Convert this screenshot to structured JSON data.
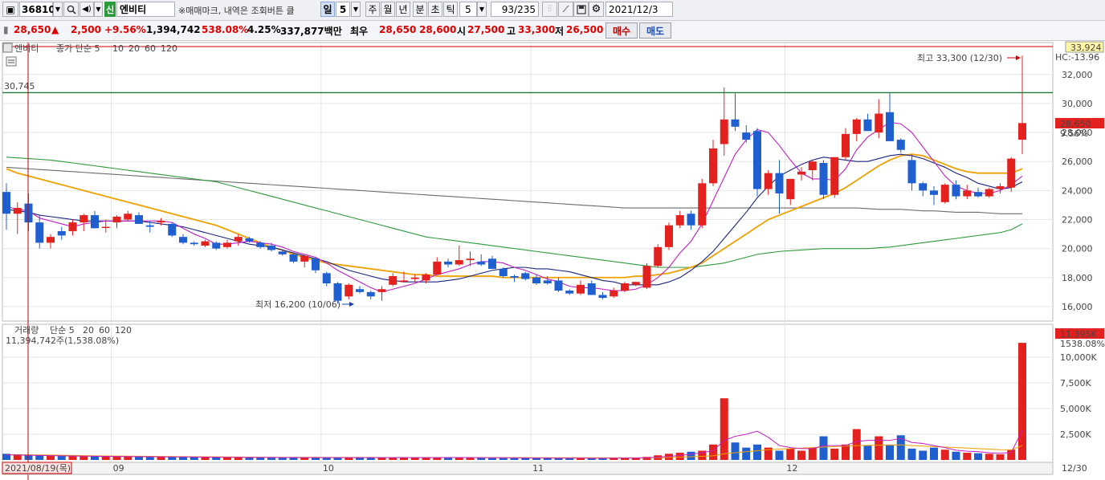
{
  "toolbar": {
    "stock_code": "36810",
    "stock_badge": "신",
    "stock_name": "엔비티",
    "notice": "※매매마크, 내역은 조회버튼 클",
    "periods": [
      "일",
      "5",
      "주",
      "월",
      "년",
      "분",
      "초",
      "틱"
    ],
    "selected_period": "일",
    "minute_value": "5",
    "count": "93/235",
    "date": "2021/12/3"
  },
  "quote": {
    "price": "28,650",
    "change_arrow": "▲",
    "change": "2,500",
    "change_pct": "+9.56%",
    "volume": "1,394,742",
    "volume_ratio": "538.08%",
    "turnover": "4.25%",
    "amount": "337,877백만",
    "bid_label": "최우",
    "ask": "28,650",
    "bid": "28,600",
    "open_label": "시",
    "open": "27,500",
    "high_label": "고",
    "high": "33,300",
    "low_label": "저",
    "low": "26,500",
    "buy_button": "매수",
    "sell_button": "매도"
  },
  "price_panel": {
    "legend_name": "엔비티",
    "legend_ma": "종가 단순 5",
    "ma_periods": [
      "10",
      "20",
      "60",
      "120"
    ],
    "hline_value": "30,745",
    "max_label": "최고 33,300 (12/30)",
    "min_label": "최저 16,200 (10/06)",
    "top_axis_value": "33,924",
    "hc_label": "HC:-13.96",
    "current_price_tag": "28,650",
    "current_pct_tag": "9.56%",
    "y_ticks": [
      "32,000",
      "30,000",
      "28,000",
      "26,000",
      "24,000",
      "22,000",
      "20,000",
      "18,000",
      "16,000"
    ]
  },
  "volume_panel": {
    "legend_name": "거래량",
    "legend_ma": "단순 5",
    "ma_periods": [
      "20",
      "60",
      "120"
    ],
    "current_volume": "11,394,742주(1,538.08%)",
    "current_tag": "11,395K",
    "current_pct_tag": "1538.08%",
    "y_ticks": [
      "10,000K",
      "7,500K",
      "5,000K",
      "2,500K"
    ]
  },
  "x_axis": {
    "start_date": "2021/08/19(목)",
    "month_labels": [
      "09",
      "10",
      "11",
      "12"
    ],
    "end_label": "12/30"
  },
  "colors": {
    "up": "#e3211f",
    "down": "#1f5fd0",
    "ma5": "#c21fc4",
    "ma10": "#1a237e",
    "ma20": "#f0a000",
    "ma60": "#2e9a3c",
    "ma120": "#6b6b6b",
    "hline": "#1f7a3a",
    "high_line": "#cc0000"
  },
  "chart_data": {
    "type": "candlestick",
    "start_date": "2021-08-19",
    "end_date": "2021-12-30",
    "unit": "KRW",
    "ylim": [
      15000,
      33924
    ],
    "candles": [
      [
        23900,
        24500,
        21300,
        22400
      ],
      [
        22400,
        23200,
        21000,
        22800
      ],
      [
        23100,
        23800,
        21200,
        21800
      ],
      [
        21800,
        22300,
        20000,
        20400
      ],
      [
        20400,
        21000,
        20000,
        20800
      ],
      [
        21200,
        21500,
        20600,
        20900
      ],
      [
        21200,
        22000,
        20900,
        21800
      ],
      [
        21800,
        22400,
        21200,
        22300
      ],
      [
        22300,
        22600,
        21400,
        21400
      ],
      [
        21500,
        22000,
        21100,
        21500
      ],
      [
        21800,
        22300,
        21400,
        22200
      ],
      [
        22000,
        22600,
        21900,
        22400
      ],
      [
        22300,
        22500,
        21700,
        21700
      ],
      [
        21600,
        21900,
        21100,
        21500
      ],
      [
        21800,
        22100,
        21600,
        21900
      ],
      [
        21700,
        21800,
        20800,
        20900
      ],
      [
        20800,
        21000,
        20300,
        20400
      ],
      [
        20400,
        20500,
        20200,
        20300
      ],
      [
        20200,
        20600,
        20100,
        20500
      ],
      [
        20400,
        20500,
        19900,
        20000
      ],
      [
        20100,
        20600,
        20000,
        20400
      ],
      [
        20500,
        21000,
        20200,
        20800
      ],
      [
        20700,
        20800,
        20400,
        20500
      ],
      [
        20400,
        20500,
        20000,
        20100
      ],
      [
        20200,
        20400,
        19800,
        19900
      ],
      [
        19800,
        19900,
        19500,
        19600
      ],
      [
        19600,
        19700,
        19000,
        19100
      ],
      [
        19100,
        19600,
        18700,
        19500
      ],
      [
        19300,
        19400,
        18300,
        18500
      ],
      [
        18300,
        18400,
        17400,
        17600
      ],
      [
        17600,
        17700,
        16200,
        16400
      ],
      [
        16700,
        17600,
        16500,
        17500
      ],
      [
        17200,
        17400,
        16900,
        17000
      ],
      [
        17000,
        17100,
        16500,
        16700
      ],
      [
        17000,
        17400,
        16400,
        17200
      ],
      [
        17500,
        18300,
        17400,
        18100
      ],
      [
        17700,
        18400,
        17700,
        17800
      ],
      [
        17900,
        18200,
        17700,
        18000
      ],
      [
        17800,
        18300,
        17600,
        18200
      ],
      [
        18200,
        19400,
        18200,
        19100
      ],
      [
        19100,
        19300,
        18700,
        18900
      ],
      [
        18900,
        20200,
        18800,
        19200
      ],
      [
        19200,
        19800,
        18800,
        19300
      ],
      [
        19100,
        19600,
        18800,
        18900
      ],
      [
        19300,
        19500,
        18600,
        18600
      ],
      [
        18600,
        18700,
        18000,
        18100
      ],
      [
        18100,
        18200,
        17700,
        18000
      ],
      [
        18300,
        18400,
        17800,
        17900
      ],
      [
        18000,
        18200,
        17500,
        17600
      ],
      [
        17800,
        18100,
        17500,
        17600
      ],
      [
        17800,
        18000,
        17000,
        17100
      ],
      [
        17100,
        17200,
        16800,
        16900
      ],
      [
        16900,
        17800,
        16800,
        17500
      ],
      [
        17600,
        17800,
        16800,
        16800
      ],
      [
        16800,
        17000,
        16500,
        16600
      ],
      [
        16700,
        17300,
        16600,
        17100
      ],
      [
        17100,
        17700,
        17000,
        17600
      ],
      [
        17500,
        17700,
        17400,
        17700
      ],
      [
        17300,
        19000,
        17200,
        18800
      ],
      [
        18800,
        20300,
        18700,
        20100
      ],
      [
        20100,
        21800,
        19900,
        21600
      ],
      [
        21600,
        22600,
        21400,
        22300
      ],
      [
        22400,
        22600,
        21300,
        21600
      ],
      [
        21600,
        24800,
        21400,
        24500
      ],
      [
        24500,
        27500,
        24300,
        26900
      ],
      [
        27200,
        31100,
        26400,
        28900
      ],
      [
        28900,
        30700,
        28100,
        28400
      ],
      [
        28000,
        28500,
        27300,
        27500
      ],
      [
        28100,
        28300,
        23600,
        24100
      ],
      [
        24100,
        25400,
        23700,
        25200
      ],
      [
        25200,
        26100,
        22400,
        23800
      ],
      [
        23400,
        24800,
        23000,
        24800
      ],
      [
        25100,
        25600,
        24700,
        25300
      ],
      [
        25400,
        26100,
        24700,
        26000
      ],
      [
        25900,
        26100,
        23400,
        23700
      ],
      [
        23700,
        26200,
        23500,
        26300
      ],
      [
        26300,
        28300,
        26100,
        27900
      ],
      [
        27900,
        29000,
        27400,
        28900
      ],
      [
        28900,
        29300,
        28400,
        28100
      ],
      [
        28000,
        30300,
        27600,
        29300
      ],
      [
        29400,
        30700,
        28700,
        27400
      ],
      [
        27500,
        27600,
        26600,
        26800
      ],
      [
        26100,
        26500,
        24000,
        24500
      ],
      [
        24500,
        24600,
        23600,
        24000
      ],
      [
        24000,
        24300,
        23000,
        23700
      ],
      [
        23200,
        24500,
        23100,
        24400
      ],
      [
        24400,
        24700,
        23400,
        23600
      ],
      [
        23600,
        24400,
        23400,
        24000
      ],
      [
        23900,
        24200,
        23500,
        23600
      ],
      [
        23600,
        24200,
        23500,
        24100
      ],
      [
        24100,
        24500,
        23800,
        24300
      ],
      [
        24200,
        26300,
        23900,
        26200
      ],
      [
        27500,
        33300,
        26500,
        28650
      ]
    ],
    "ma5": [
      22900,
      22700,
      22600,
      22100,
      21900,
      21700,
      21500,
      21700,
      21800,
      21900,
      21900,
      21900,
      21900,
      21900,
      21900,
      21800,
      21400,
      21000,
      20700,
      20300,
      20300,
      20400,
      20500,
      20400,
      20300,
      20100,
      19800,
      19600,
      19400,
      19000,
      18500,
      18100,
      17700,
      17300,
      17000,
      17200,
      17400,
      17600,
      17900,
      18200,
      18400,
      18600,
      18900,
      19100,
      19100,
      19000,
      18700,
      18500,
      18200,
      17900,
      17700,
      17400,
      17300,
      17300,
      17200,
      17100,
      17100,
      17200,
      17500,
      18000,
      18700,
      19700,
      20500,
      21700,
      23300,
      24900,
      26500,
      27500,
      28200,
      28000,
      27100,
      26100,
      25200,
      24800,
      24800,
      24700,
      25500,
      26800,
      27700,
      28200,
      28700,
      28600,
      28000,
      27000,
      26000,
      25000,
      24300,
      24000,
      23800,
      23800,
      24000,
      24400,
      25000
    ],
    "ma10": [
      22700,
      22600,
      22500,
      22300,
      22200,
      22100,
      22000,
      21900,
      21900,
      21900,
      21900,
      21900,
      21900,
      21800,
      21700,
      21600,
      21500,
      21300,
      21100,
      20900,
      20700,
      20500,
      20300,
      20200,
      20100,
      19900,
      19700,
      19500,
      19300,
      19100,
      18800,
      18500,
      18300,
      18100,
      17900,
      17800,
      17700,
      17700,
      17700,
      17700,
      17800,
      17900,
      18100,
      18300,
      18500,
      18600,
      18700,
      18700,
      18600,
      18600,
      18500,
      18400,
      18200,
      18000,
      17800,
      17700,
      17500,
      17500,
      17500,
      17500,
      17700,
      18000,
      18500,
      19100,
      19800,
      20700,
      21600,
      22500,
      23500,
      24300,
      25000,
      25400,
      25800,
      26100,
      26300,
      26200,
      26100,
      26000,
      26000,
      26200,
      26400,
      26500,
      26400,
      26200,
      25900,
      25600,
      25200,
      24900,
      24500,
      24300,
      24100,
      24200,
      24600
    ],
    "ma20": [
      25500,
      25200,
      25000,
      24800,
      24600,
      24400,
      24200,
      24000,
      23800,
      23600,
      23400,
      23200,
      23000,
      22800,
      22600,
      22400,
      22200,
      22000,
      21800,
      21600,
      21300,
      21000,
      20700,
      20400,
      20100,
      19900,
      19600,
      19400,
      19200,
      19000,
      18900,
      18800,
      18700,
      18600,
      18500,
      18400,
      18300,
      18200,
      18200,
      18100,
      18100,
      18100,
      18100,
      18100,
      18100,
      18000,
      18000,
      18000,
      18000,
      18000,
      18000,
      18000,
      18000,
      18000,
      18000,
      18000,
      18000,
      18100,
      18100,
      18200,
      18300,
      18500,
      18700,
      19000,
      19500,
      20000,
      20500,
      21000,
      21500,
      22000,
      22300,
      22600,
      22900,
      23200,
      23500,
      23800,
      24200,
      24700,
      25200,
      25700,
      26100,
      26400,
      26500,
      26400,
      26100,
      25800,
      25500,
      25300,
      25200,
      25200,
      25200,
      25200,
      25500
    ],
    "ma60": [
      26300,
      26250,
      26200,
      26150,
      26100,
      26000,
      25900,
      25800,
      25700,
      25600,
      25500,
      25400,
      25300,
      25200,
      25100,
      25000,
      24900,
      24800,
      24700,
      24600,
      24400,
      24200,
      24000,
      23800,
      23600,
      23400,
      23200,
      23000,
      22800,
      22600,
      22400,
      22200,
      22000,
      21800,
      21600,
      21400,
      21200,
      21000,
      20800,
      20700,
      20600,
      20500,
      20400,
      20300,
      20200,
      20100,
      20000,
      19900,
      19800,
      19700,
      19600,
      19500,
      19400,
      19300,
      19200,
      19100,
      19000,
      18900,
      18800,
      18700,
      18700,
      18700,
      18700,
      18800,
      18900,
      19000,
      19200,
      19400,
      19600,
      19700,
      19800,
      19850,
      19900,
      19950,
      20000,
      20000,
      20000,
      20000,
      20000,
      20050,
      20100,
      20200,
      20300,
      20400,
      20500,
      20600,
      20700,
      20800,
      20900,
      21000,
      21100,
      21300,
      21700
    ],
    "ma120": [
      25600,
      25550,
      25500,
      25450,
      25400,
      25350,
      25300,
      25250,
      25200,
      25150,
      25100,
      25050,
      25000,
      24950,
      24900,
      24850,
      24800,
      24750,
      24700,
      24650,
      24600,
      24550,
      24500,
      24450,
      24400,
      24350,
      24300,
      24250,
      24200,
      24150,
      24100,
      24050,
      24000,
      23950,
      23900,
      23850,
      23800,
      23750,
      23700,
      23650,
      23600,
      23550,
      23500,
      23450,
      23400,
      23350,
      23300,
      23250,
      23200,
      23150,
      23100,
      23050,
      23000,
      22950,
      22900,
      22850,
      22800,
      22800,
      22800,
      22800,
      22800,
      22800,
      22800,
      22800,
      22800,
      22800,
      22800,
      22800,
      22800,
      22800,
      22800,
      22800,
      22800,
      22800,
      22800,
      22800,
      22800,
      22800,
      22750,
      22700,
      22700,
      22700,
      22650,
      22600,
      22600,
      22550,
      22500,
      22500,
      22500,
      22450,
      22400,
      22400,
      22400
    ],
    "volume": [
      600,
      550,
      500,
      450,
      400,
      400,
      380,
      360,
      350,
      340,
      330,
      320,
      310,
      300,
      300,
      290,
      280,
      270,
      260,
      260,
      250,
      250,
      240,
      240,
      230,
      230,
      220,
      220,
      220,
      230,
      250,
      230,
      220,
      210,
      220,
      240,
      230,
      220,
      220,
      250,
      230,
      240,
      220,
      210,
      200,
      190,
      180,
      190,
      180,
      170,
      170,
      160,
      170,
      180,
      170,
      180,
      200,
      220,
      300,
      450,
      600,
      700,
      800,
      900,
      1500,
      6000,
      1700,
      1200,
      1500,
      1200,
      900,
      1100,
      900,
      1200,
      2300,
      1100,
      1500,
      3000,
      1400,
      2300,
      1500,
      2400,
      1100,
      900,
      1200,
      1000,
      800,
      700,
      650,
      600,
      550,
      1000,
      11395
    ],
    "volume_ma5": [
      500,
      480,
      460,
      440,
      420,
      400,
      380,
      370,
      360,
      350,
      340,
      330,
      320,
      310,
      300,
      295,
      290,
      280,
      270,
      265,
      258,
      252,
      248,
      244,
      240,
      236,
      232,
      228,
      226,
      226,
      228,
      228,
      228,
      226,
      226,
      228,
      228,
      226,
      226,
      228,
      230,
      230,
      228,
      224,
      218,
      212,
      204,
      196,
      188,
      182,
      178,
      174,
      172,
      170,
      170,
      172,
      178,
      190,
      210,
      260,
      340,
      440,
      560,
      700,
      900,
      1900,
      2300,
      2500,
      2800,
      2200,
      1400,
      1200,
      1100,
      1100,
      1400,
      1400,
      1400,
      1800,
      1900,
      1900,
      1900,
      2100,
      1700,
      1600,
      1400,
      1200,
      950,
      850,
      800,
      700,
      650,
      720,
      2900
    ],
    "volume_ma20": [
      520,
      510,
      500,
      490,
      480,
      460,
      440,
      420,
      400,
      390,
      380,
      370,
      360,
      350,
      340,
      330,
      320,
      310,
      300,
      300,
      290,
      280,
      270,
      260,
      258,
      256,
      254,
      252,
      250,
      248,
      246,
      244,
      242,
      240,
      238,
      236,
      234,
      232,
      230,
      230,
      230,
      230,
      230,
      228,
      226,
      224,
      222,
      220,
      218,
      216,
      214,
      212,
      210,
      208,
      206,
      204,
      204,
      206,
      210,
      220,
      240,
      270,
      310,
      350,
      400,
      600,
      700,
      800,
      900,
      1000,
      1050,
      1100,
      1150,
      1200,
      1250,
      1300,
      1350,
      1400,
      1420,
      1440,
      1450,
      1460,
      1400,
      1350,
      1300,
      1250,
      1200,
      1150,
      1100,
      1050,
      1000,
      980,
      1400
    ]
  }
}
